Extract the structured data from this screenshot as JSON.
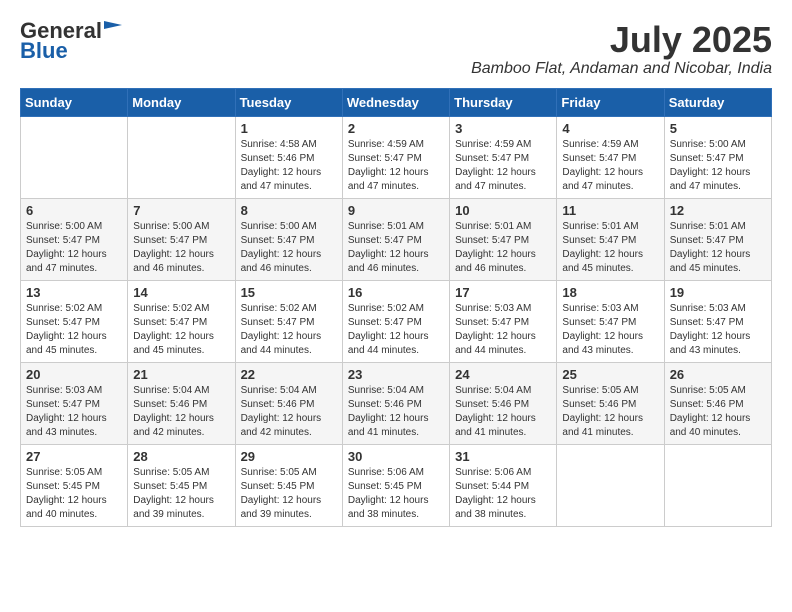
{
  "header": {
    "logo_general": "General",
    "logo_blue": "Blue",
    "month_year": "July 2025",
    "location": "Bamboo Flat, Andaman and Nicobar, India"
  },
  "weekdays": [
    "Sunday",
    "Monday",
    "Tuesday",
    "Wednesday",
    "Thursday",
    "Friday",
    "Saturday"
  ],
  "weeks": [
    [
      {
        "day": "",
        "info": ""
      },
      {
        "day": "",
        "info": ""
      },
      {
        "day": "1",
        "info": "Sunrise: 4:58 AM\nSunset: 5:46 PM\nDaylight: 12 hours and 47 minutes."
      },
      {
        "day": "2",
        "info": "Sunrise: 4:59 AM\nSunset: 5:47 PM\nDaylight: 12 hours and 47 minutes."
      },
      {
        "day": "3",
        "info": "Sunrise: 4:59 AM\nSunset: 5:47 PM\nDaylight: 12 hours and 47 minutes."
      },
      {
        "day": "4",
        "info": "Sunrise: 4:59 AM\nSunset: 5:47 PM\nDaylight: 12 hours and 47 minutes."
      },
      {
        "day": "5",
        "info": "Sunrise: 5:00 AM\nSunset: 5:47 PM\nDaylight: 12 hours and 47 minutes."
      }
    ],
    [
      {
        "day": "6",
        "info": "Sunrise: 5:00 AM\nSunset: 5:47 PM\nDaylight: 12 hours and 47 minutes."
      },
      {
        "day": "7",
        "info": "Sunrise: 5:00 AM\nSunset: 5:47 PM\nDaylight: 12 hours and 46 minutes."
      },
      {
        "day": "8",
        "info": "Sunrise: 5:00 AM\nSunset: 5:47 PM\nDaylight: 12 hours and 46 minutes."
      },
      {
        "day": "9",
        "info": "Sunrise: 5:01 AM\nSunset: 5:47 PM\nDaylight: 12 hours and 46 minutes."
      },
      {
        "day": "10",
        "info": "Sunrise: 5:01 AM\nSunset: 5:47 PM\nDaylight: 12 hours and 46 minutes."
      },
      {
        "day": "11",
        "info": "Sunrise: 5:01 AM\nSunset: 5:47 PM\nDaylight: 12 hours and 45 minutes."
      },
      {
        "day": "12",
        "info": "Sunrise: 5:01 AM\nSunset: 5:47 PM\nDaylight: 12 hours and 45 minutes."
      }
    ],
    [
      {
        "day": "13",
        "info": "Sunrise: 5:02 AM\nSunset: 5:47 PM\nDaylight: 12 hours and 45 minutes."
      },
      {
        "day": "14",
        "info": "Sunrise: 5:02 AM\nSunset: 5:47 PM\nDaylight: 12 hours and 45 minutes."
      },
      {
        "day": "15",
        "info": "Sunrise: 5:02 AM\nSunset: 5:47 PM\nDaylight: 12 hours and 44 minutes."
      },
      {
        "day": "16",
        "info": "Sunrise: 5:02 AM\nSunset: 5:47 PM\nDaylight: 12 hours and 44 minutes."
      },
      {
        "day": "17",
        "info": "Sunrise: 5:03 AM\nSunset: 5:47 PM\nDaylight: 12 hours and 44 minutes."
      },
      {
        "day": "18",
        "info": "Sunrise: 5:03 AM\nSunset: 5:47 PM\nDaylight: 12 hours and 43 minutes."
      },
      {
        "day": "19",
        "info": "Sunrise: 5:03 AM\nSunset: 5:47 PM\nDaylight: 12 hours and 43 minutes."
      }
    ],
    [
      {
        "day": "20",
        "info": "Sunrise: 5:03 AM\nSunset: 5:47 PM\nDaylight: 12 hours and 43 minutes."
      },
      {
        "day": "21",
        "info": "Sunrise: 5:04 AM\nSunset: 5:46 PM\nDaylight: 12 hours and 42 minutes."
      },
      {
        "day": "22",
        "info": "Sunrise: 5:04 AM\nSunset: 5:46 PM\nDaylight: 12 hours and 42 minutes."
      },
      {
        "day": "23",
        "info": "Sunrise: 5:04 AM\nSunset: 5:46 PM\nDaylight: 12 hours and 41 minutes."
      },
      {
        "day": "24",
        "info": "Sunrise: 5:04 AM\nSunset: 5:46 PM\nDaylight: 12 hours and 41 minutes."
      },
      {
        "day": "25",
        "info": "Sunrise: 5:05 AM\nSunset: 5:46 PM\nDaylight: 12 hours and 41 minutes."
      },
      {
        "day": "26",
        "info": "Sunrise: 5:05 AM\nSunset: 5:46 PM\nDaylight: 12 hours and 40 minutes."
      }
    ],
    [
      {
        "day": "27",
        "info": "Sunrise: 5:05 AM\nSunset: 5:45 PM\nDaylight: 12 hours and 40 minutes."
      },
      {
        "day": "28",
        "info": "Sunrise: 5:05 AM\nSunset: 5:45 PM\nDaylight: 12 hours and 39 minutes."
      },
      {
        "day": "29",
        "info": "Sunrise: 5:05 AM\nSunset: 5:45 PM\nDaylight: 12 hours and 39 minutes."
      },
      {
        "day": "30",
        "info": "Sunrise: 5:06 AM\nSunset: 5:45 PM\nDaylight: 12 hours and 38 minutes."
      },
      {
        "day": "31",
        "info": "Sunrise: 5:06 AM\nSunset: 5:44 PM\nDaylight: 12 hours and 38 minutes."
      },
      {
        "day": "",
        "info": ""
      },
      {
        "day": "",
        "info": ""
      }
    ]
  ]
}
